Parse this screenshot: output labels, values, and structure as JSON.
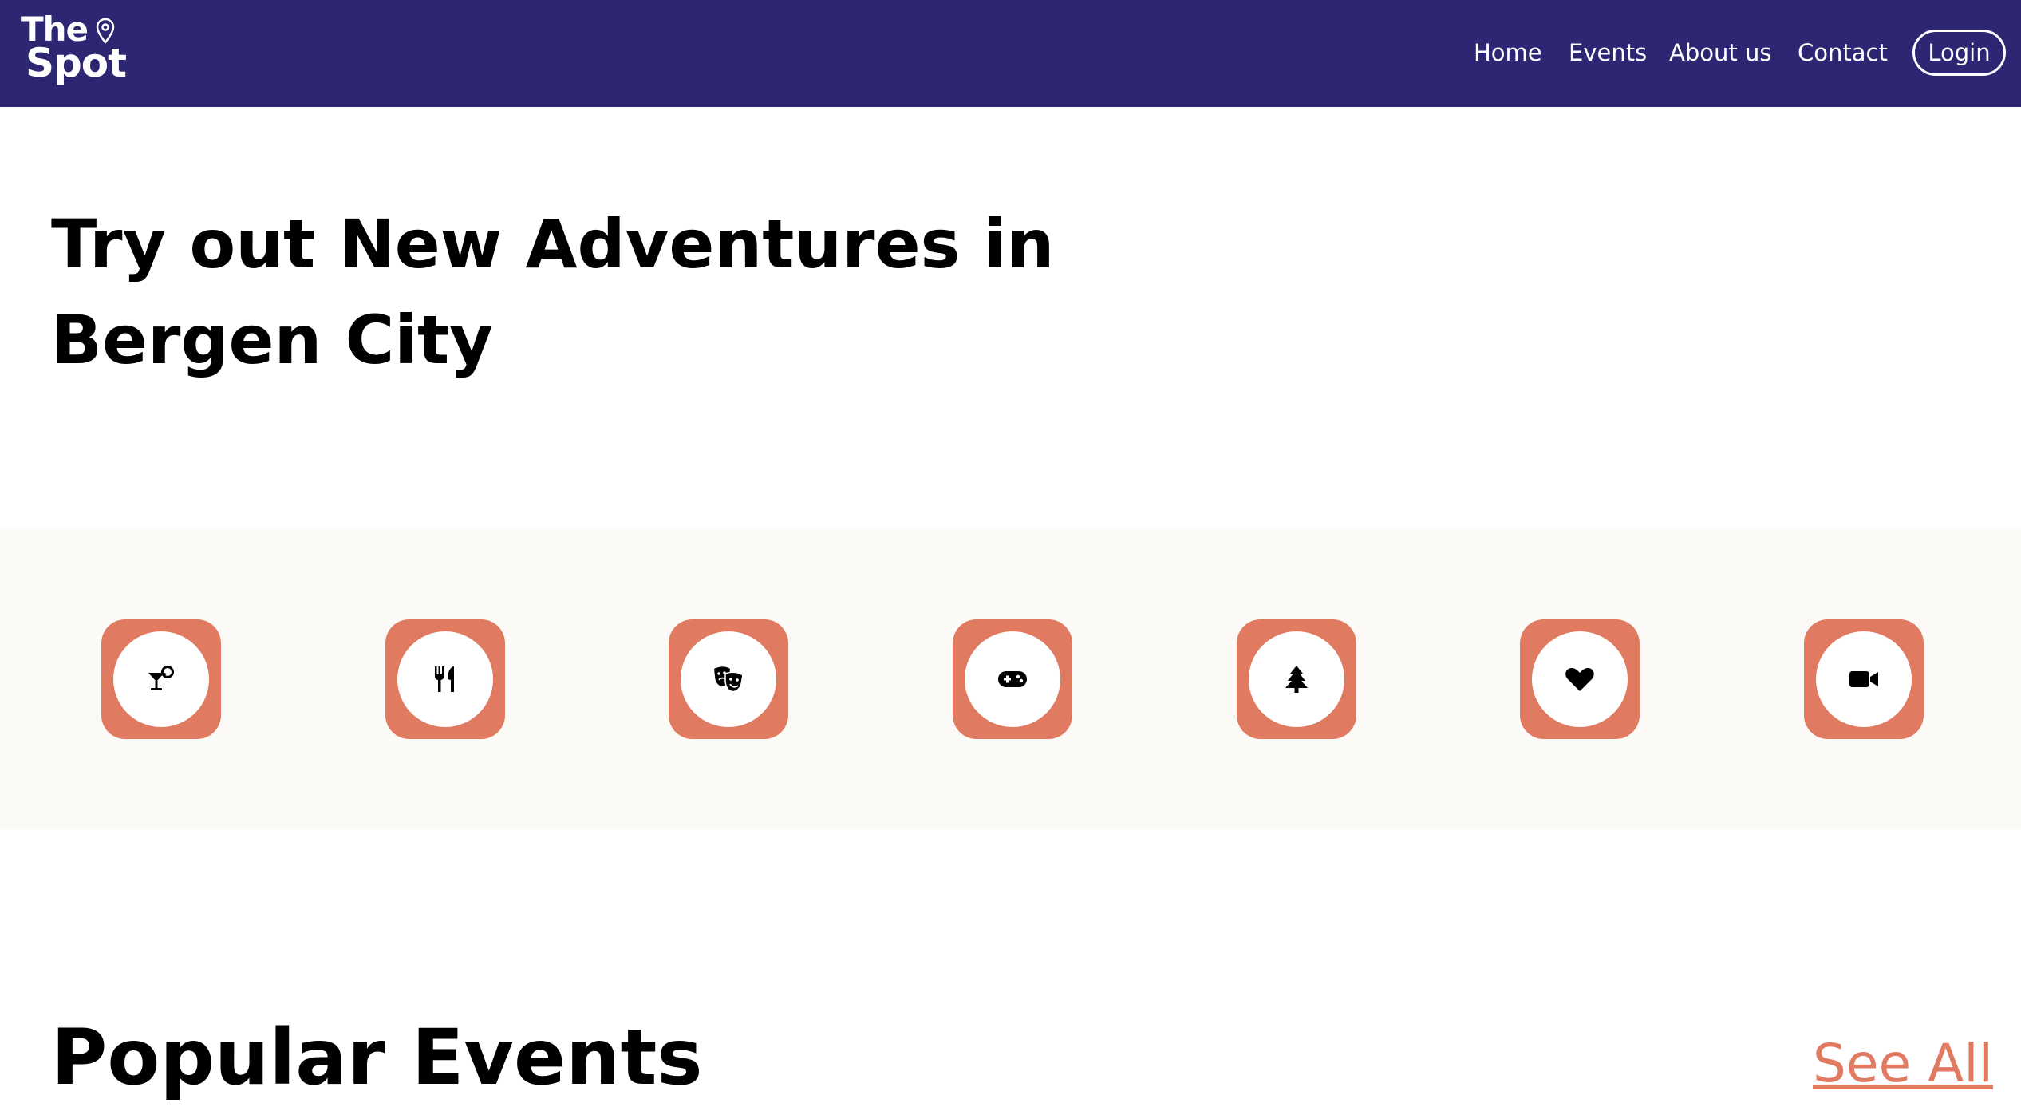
{
  "brand": {
    "line1": "The",
    "line2": "Spot",
    "pin_icon": "map-pin-icon",
    "color_header_bg": "#2d2672",
    "color_text": "#ffffff"
  },
  "nav": {
    "items": [
      {
        "label": "Home"
      },
      {
        "label": "Events"
      },
      {
        "label": "About us"
      },
      {
        "label": "Contact"
      }
    ],
    "login_label": "Login"
  },
  "hero": {
    "title": "Try out New Adventures in Bergen City"
  },
  "categories": {
    "background": "#fbfaf6",
    "tile_color": "#e07a61",
    "items": [
      {
        "icon": "cocktail-icon"
      },
      {
        "icon": "utensils-icon"
      },
      {
        "icon": "theater-masks-icon"
      },
      {
        "icon": "gamepad-icon"
      },
      {
        "icon": "tree-icon"
      },
      {
        "icon": "heart-icon"
      },
      {
        "icon": "video-camera-icon"
      }
    ]
  },
  "popular": {
    "title": "Popular Events",
    "see_all_label": "See All",
    "link_color": "#e07a61"
  }
}
